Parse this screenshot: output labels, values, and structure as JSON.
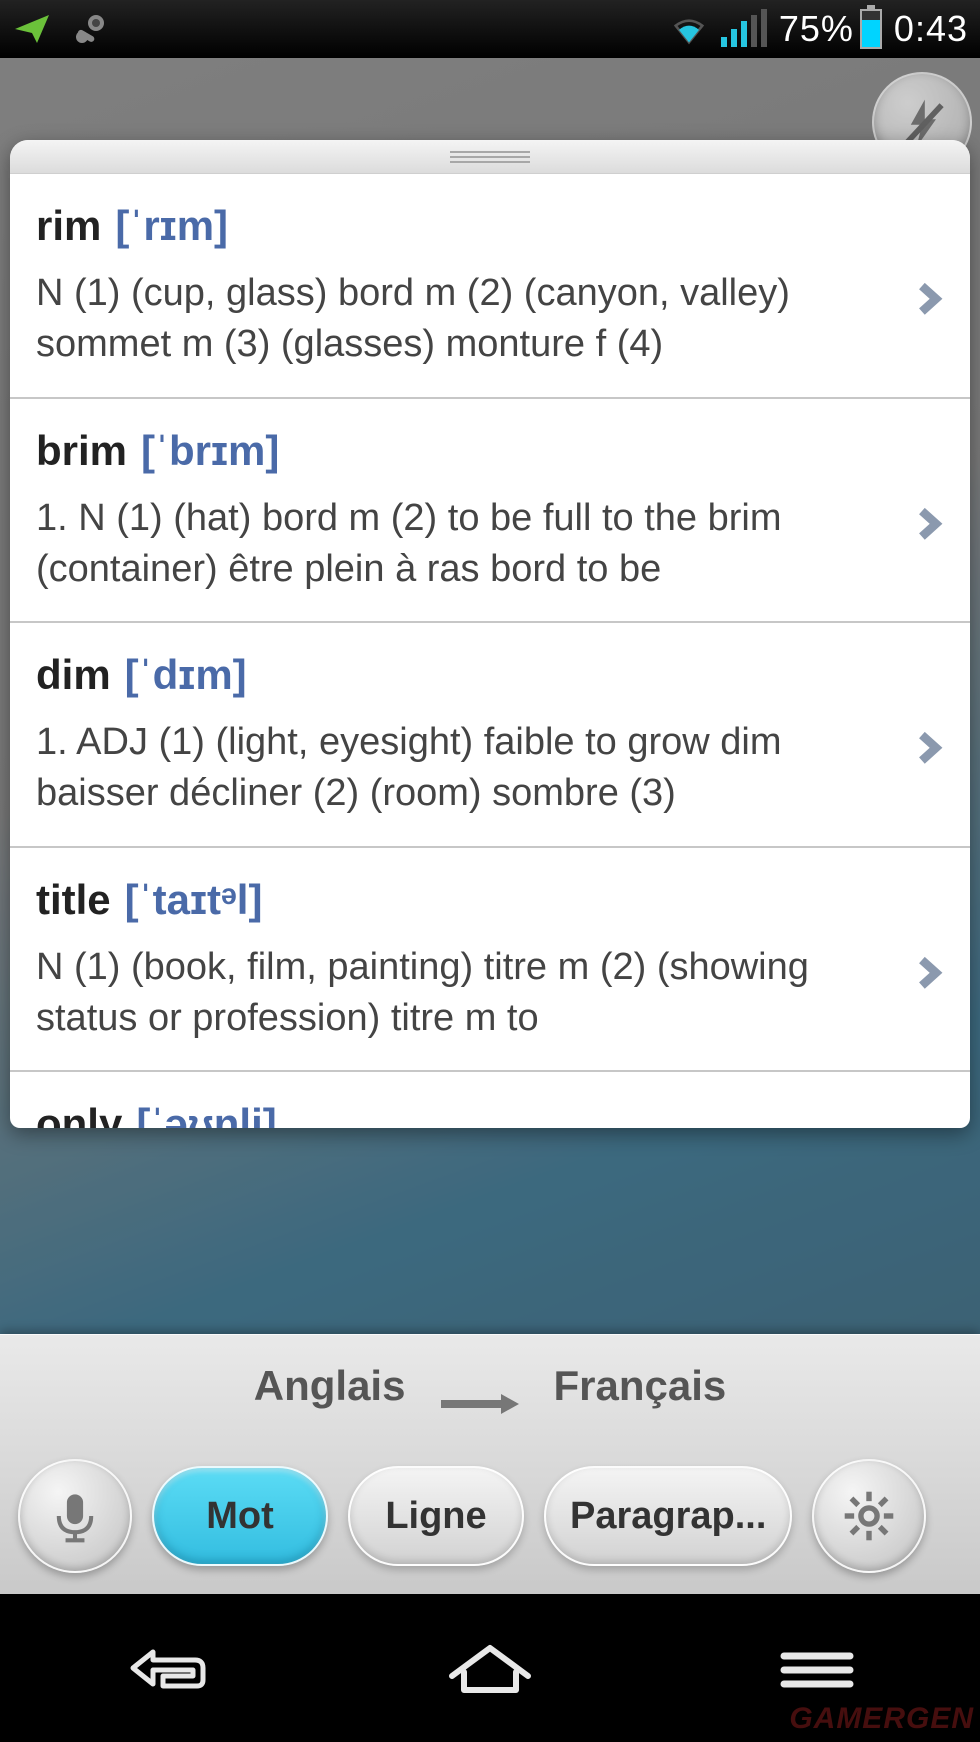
{
  "status": {
    "battery_pct": "75%",
    "time": "0:43"
  },
  "entries": [
    {
      "word": "rim",
      "phon": "[ˈrɪm]",
      "def": "N (1) (cup, glass) bord m (2) (canyon, valley) sommet m (3) (glasses) monture f (4)"
    },
    {
      "word": "brim",
      "phon": "[ˈbrɪm]",
      "def": "1. N (1) (hat) bord m (2) to be full to the brim (container) être plein à ras bord to be"
    },
    {
      "word": "dim",
      "phon": "[ˈdɪm]",
      "def": "1. ADJ (1) (light, eyesight) faible to grow dim baisser décliner (2)  (room) sombre (3)"
    },
    {
      "word": "title",
      "phon": "[ˈtaɪtᵊl]",
      "def": "N (1) (book, film, painting) titre m (2) (showing status or profession) titre m to"
    },
    {
      "word": "only",
      "phon": "[ˈəʊnli]",
      "def": ""
    }
  ],
  "lang": {
    "from": "Anglais",
    "to": "Français"
  },
  "controls": {
    "mot": "Mot",
    "ligne": "Ligne",
    "paragraphe": "Paragrap..."
  },
  "watermark": "GAMERGEN"
}
